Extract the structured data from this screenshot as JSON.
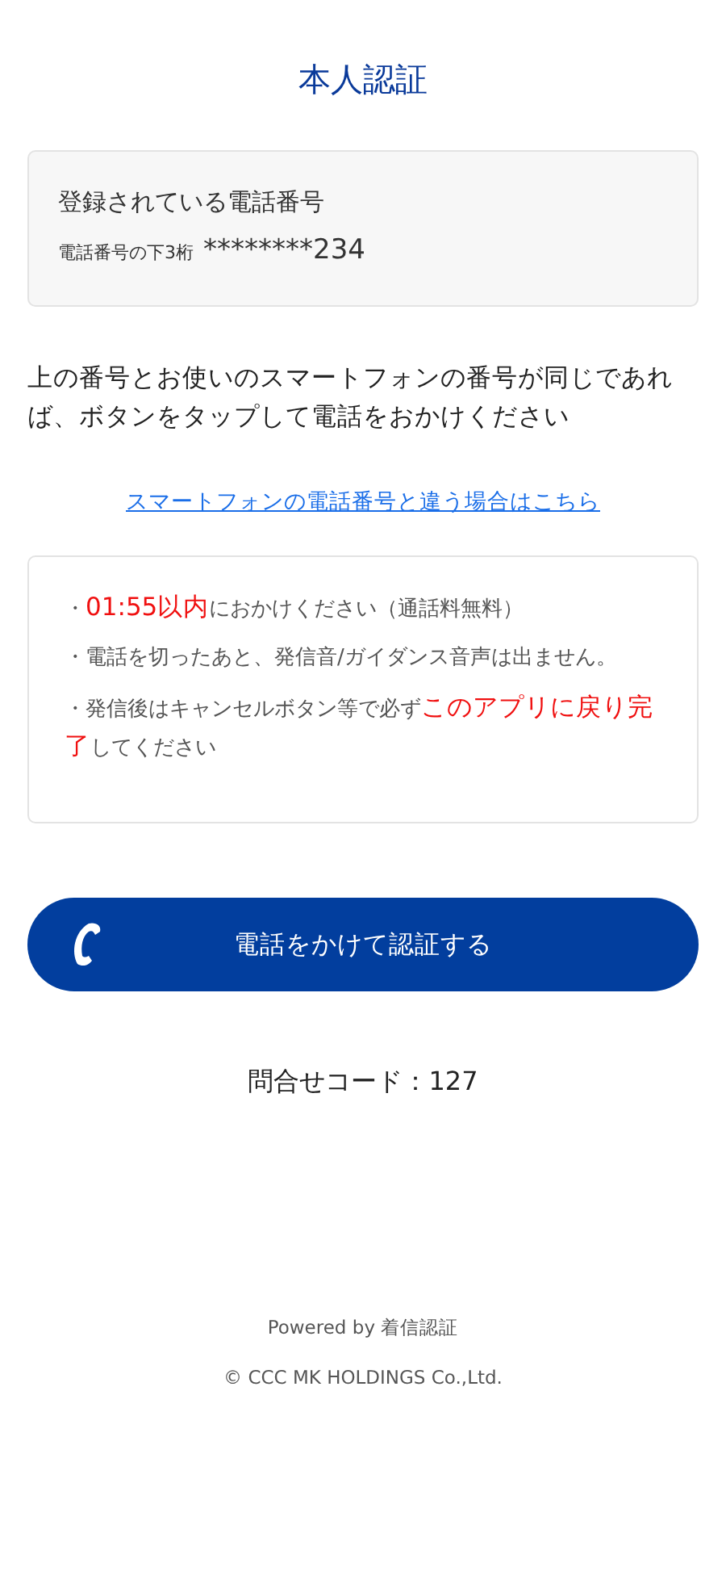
{
  "title": "本人認証",
  "registered": {
    "heading": "登録されている電話番号",
    "label": "電話番号の下3桁",
    "number": "********234"
  },
  "instruction": "上の番号とお使いのスマートフォンの番号が同じであれば、ボタンをタップして電話をおかけください",
  "link": "スマートフォンの電話番号と違う場合はこちら",
  "notes": [
    {
      "segments": [
        {
          "text": "・",
          "highlight": false
        },
        {
          "text": "01:55以内",
          "highlight": true
        },
        {
          "text": "におかけください（通話料無料）",
          "highlight": false
        }
      ]
    },
    {
      "segments": [
        {
          "text": "・電話を切ったあと、発信音/ガイダンス音声は出ません。",
          "highlight": false
        }
      ]
    },
    {
      "segments": [
        {
          "text": "・発信後はキャンセルボタン等で必ず",
          "highlight": false
        },
        {
          "text": "このアプリに戻り完了",
          "highlight": true
        },
        {
          "text": "してください",
          "highlight": false
        }
      ]
    }
  ],
  "call_button": "電話をかけて認証する",
  "inquiry_code": "問合せコード：127",
  "footer": {
    "powered_by": "Powered by 着信認証",
    "copyright": "© CCC MK HOLDINGS Co.,Ltd."
  }
}
